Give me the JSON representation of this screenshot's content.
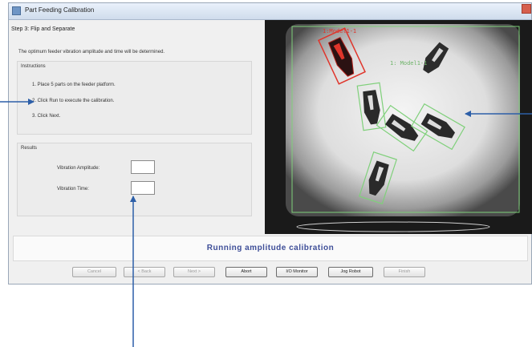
{
  "window": {
    "title": "Part Feeding Calibration"
  },
  "step": {
    "title": "Step 3: Flip and Separate",
    "description": "The optimum feeder vibration amplitude and time will be determined."
  },
  "instructions": {
    "label": "Instructions",
    "items": [
      "1. Place 5 parts on the feeder platform.",
      "2. Click Run to execute the calibration.",
      "3. Click Next."
    ]
  },
  "results": {
    "label": "Results",
    "amplitude_label": "Vibration Amplitude:",
    "time_label": "Vibration Time:",
    "amplitude_value": "",
    "time_value": ""
  },
  "camera": {
    "part_labels": [
      "1: Model1-1",
      "1: Model1-1"
    ],
    "colors": {
      "accepted": "#7fd07a",
      "rejected": "#e0352b"
    }
  },
  "status": {
    "text": "Running amplitude calibration",
    "color": "#3e4e98"
  },
  "buttons": {
    "cancel": "Cancel",
    "back": "< Back",
    "next": "Next >",
    "abort": "Abort",
    "io_monitor": "I/O Monitor",
    "jog_robot": "Jog Robot",
    "finish": "Finish"
  }
}
